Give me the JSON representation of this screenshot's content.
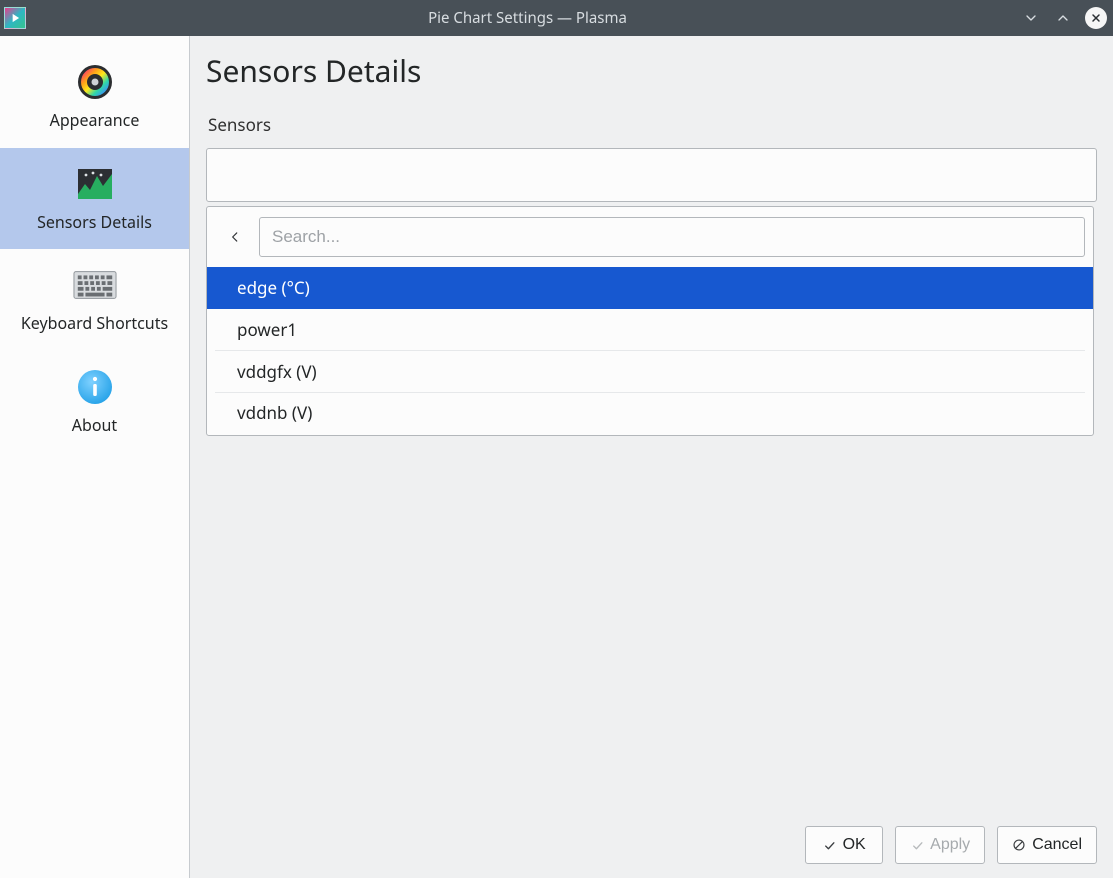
{
  "window": {
    "title": "Pie Chart Settings — Plasma"
  },
  "sidebar": {
    "items": [
      {
        "label": "Appearance"
      },
      {
        "label": "Sensors Details"
      },
      {
        "label": "Keyboard Shortcuts"
      },
      {
        "label": "About"
      }
    ],
    "selected_index": 1
  },
  "main": {
    "title": "Sensors Details",
    "sensors_label": "Sensors",
    "sensors_value": ""
  },
  "popup": {
    "search_placeholder": "Search...",
    "search_value": "",
    "options": [
      "edge (°C)",
      "power1",
      "vddgfx (V)",
      "vddnb (V)"
    ],
    "selected_index": 0
  },
  "footer": {
    "ok": "OK",
    "apply": "Apply",
    "cancel": "Cancel"
  }
}
